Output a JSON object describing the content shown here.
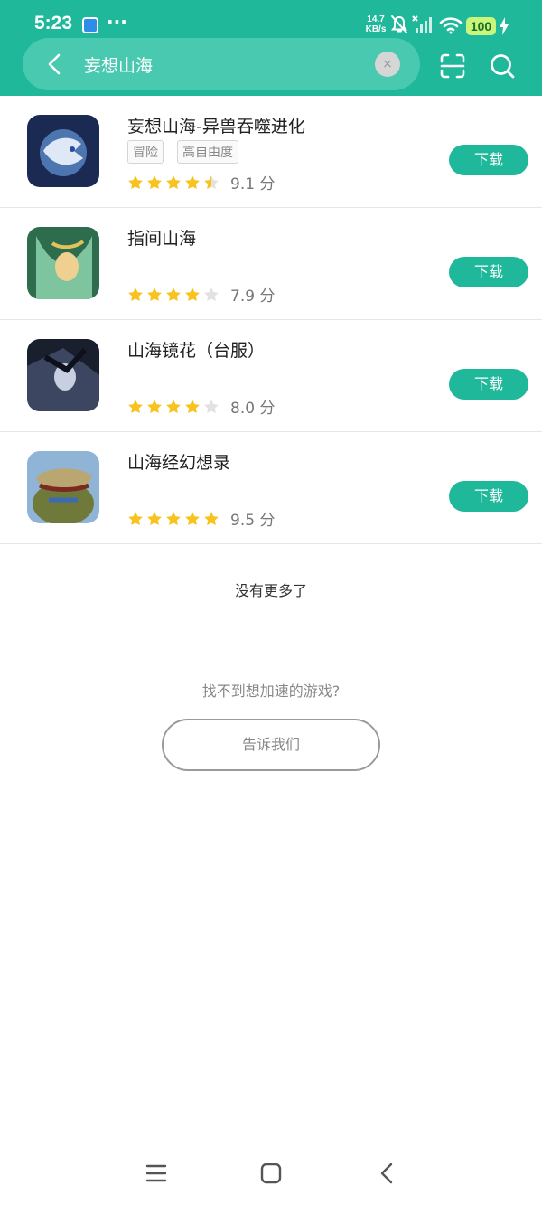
{
  "status_bar": {
    "time": "5:23",
    "dots": "···",
    "net_speed_value": "14.7",
    "net_speed_unit": "KB/s",
    "battery": "100"
  },
  "search": {
    "query": "妄想山海",
    "clear_symbol": "×"
  },
  "apps": [
    {
      "name": "妄想山海-异兽吞噬进化",
      "tags": [
        "冒险",
        "高自由度"
      ],
      "stars": 4.5,
      "score": "9.1 分",
      "button": "下载",
      "icon_colors": [
        "#1a2a52",
        "#5a8ac8",
        "#dfe8f6"
      ]
    },
    {
      "name": "指间山海",
      "tags": [],
      "stars": 4,
      "score": "7.9 分",
      "button": "下载",
      "icon_colors": [
        "#2d6d4d",
        "#7ec49e",
        "#f0d090"
      ]
    },
    {
      "name": "山海镜花（台服）",
      "tags": [],
      "stars": 4,
      "score": "8.0 分",
      "button": "下载",
      "icon_colors": [
        "#1a1f2e",
        "#3c4660",
        "#c8cfe0"
      ]
    },
    {
      "name": "山海经幻想录",
      "tags": [],
      "stars": 5,
      "score": "9.5 分",
      "button": "下载",
      "icon_colors": [
        "#8fb4d6",
        "#6f7a3a",
        "#b9a670"
      ]
    }
  ],
  "footer": {
    "no_more": "没有更多了",
    "cant_find": "找不到想加速的游戏?",
    "tell_us": "告诉我们"
  },
  "colors": {
    "brand": "#1fb89a",
    "star": "#f9c31f",
    "star_empty": "#e2e2e2"
  }
}
